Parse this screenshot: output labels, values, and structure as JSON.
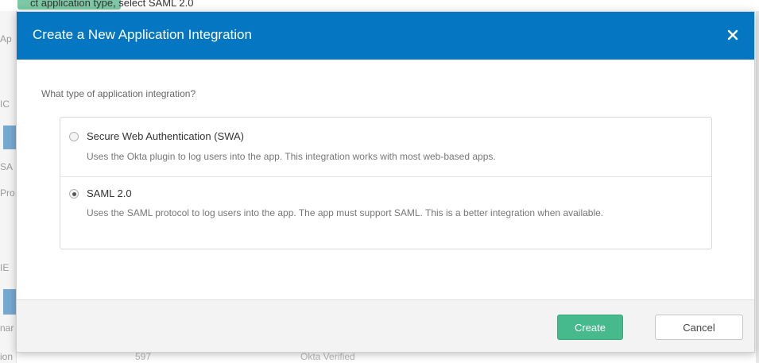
{
  "background": {
    "top_text": "ct application type, select SAML 2.0",
    "left_fragments": [
      "Ap",
      "IC",
      "SA",
      "Pro",
      "IE",
      "nar",
      "ion"
    ],
    "bottom_values": [
      "597",
      "Okta Verified"
    ]
  },
  "modal": {
    "title": "Create a New Application Integration",
    "close_icon": "close-icon",
    "question": "What type of application integration?",
    "options": [
      {
        "label": "Secure Web Authentication (SWA)",
        "description": "Uses the Okta plugin to log users into the app. This integration works with most web-based apps.",
        "selected": false
      },
      {
        "label": "SAML 2.0",
        "description": "Uses the SAML protocol to log users into the app. The app must support SAML. This is a better integration when available.",
        "selected": true
      }
    ],
    "buttons": {
      "create": "Create",
      "cancel": "Cancel"
    }
  },
  "colors": {
    "header": "#0576c1",
    "create_button": "#46b98d",
    "footer": "#f3f3f3"
  }
}
